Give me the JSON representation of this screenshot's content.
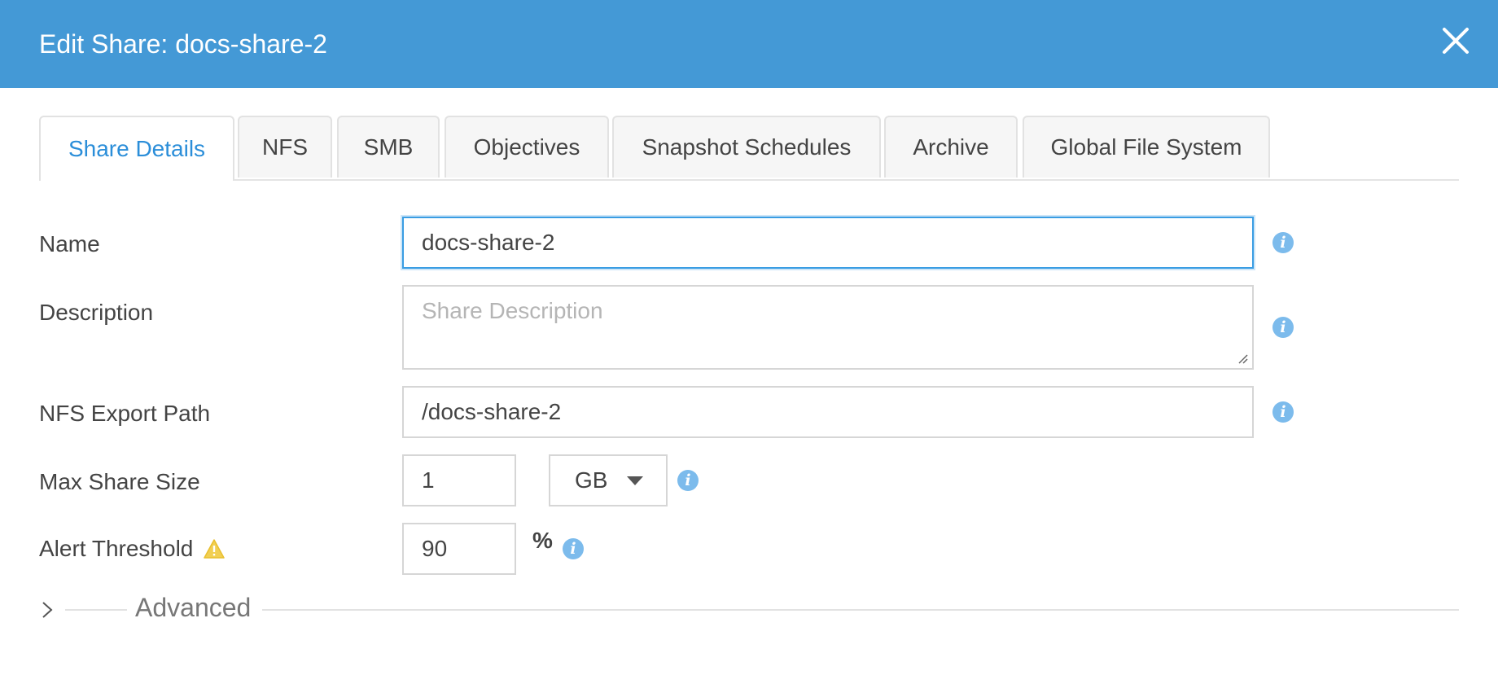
{
  "dialog": {
    "title": "Edit Share: docs-share-2",
    "header_color": "#4499d6"
  },
  "tabs": [
    {
      "label": "Share Details",
      "active": true
    },
    {
      "label": "NFS",
      "active": false
    },
    {
      "label": "SMB",
      "active": false
    },
    {
      "label": "Objectives",
      "active": false
    },
    {
      "label": "Snapshot Schedules",
      "active": false
    },
    {
      "label": "Archive",
      "active": false
    },
    {
      "label": "Global File System",
      "active": false
    }
  ],
  "form": {
    "name": {
      "label": "Name",
      "value": "docs-share-2"
    },
    "description": {
      "label": "Description",
      "value": "",
      "placeholder": "Share Description"
    },
    "nfs_export_path": {
      "label": "NFS Export Path",
      "value": "/docs-share-2"
    },
    "max_share_size": {
      "label": "Max Share Size",
      "value": "1",
      "unit": "GB"
    },
    "alert_threshold": {
      "label": "Alert Threshold",
      "value": "90",
      "unit": "%"
    }
  },
  "advanced": {
    "label": "Advanced"
  },
  "icons": {
    "close": "close-icon",
    "info": "info-icon",
    "warning": "warning-icon",
    "chevron": "chevron-right-icon",
    "dropdown": "caret-down-icon"
  },
  "colors": {
    "accent": "#2b8ed9",
    "focus_border": "#3a9de3",
    "info": "#7cbbec",
    "warning": "#f1cf52"
  }
}
